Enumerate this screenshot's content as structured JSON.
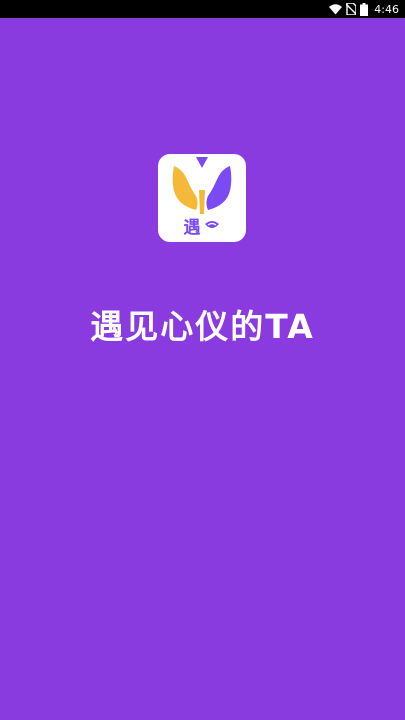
{
  "status_bar": {
    "time": "4:46",
    "icons": [
      "wifi-icon",
      "no-sim-icon",
      "battery-icon"
    ]
  },
  "splash": {
    "logo_text": "遇",
    "app_name": "遇见心仪的TA"
  },
  "colors": {
    "background": "#8a3be0",
    "logo_yellow": "#f5b93a",
    "logo_purple": "#7a4bf2"
  }
}
